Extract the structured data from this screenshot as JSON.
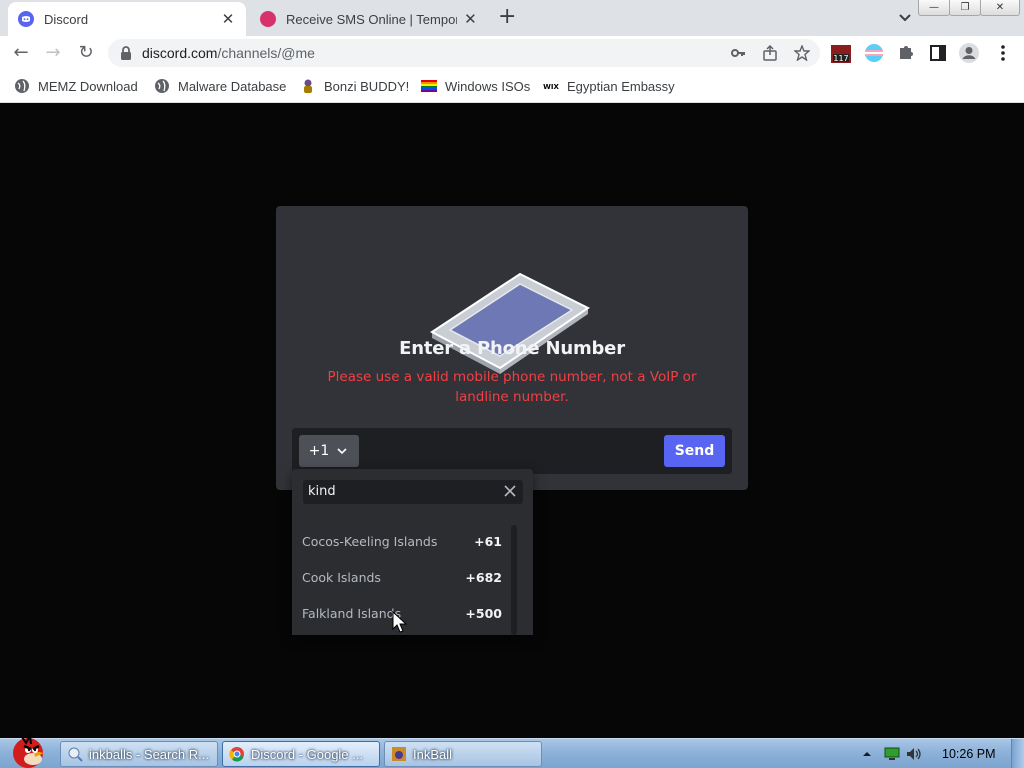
{
  "browser": {
    "tabs": [
      {
        "title": "Discord",
        "active": true,
        "icon": "discord-icon"
      },
      {
        "title": "Receive SMS Online | Tempora",
        "active": false,
        "icon": "sms-site-icon"
      }
    ],
    "window_buttons": {
      "minimize": "—",
      "restore": "❐",
      "close": "✕"
    },
    "url_host": "discord.com",
    "url_path": "/channels/@me",
    "extension_badge": "117",
    "bookmarks": [
      {
        "label": "MEMZ Download",
        "icon": "globe-icon"
      },
      {
        "label": "Malware Database",
        "icon": "globe-icon"
      },
      {
        "label": "Bonzi BUDDY!",
        "icon": "bonzi-icon"
      },
      {
        "label": "Windows ISOs",
        "icon": "rainbow-flag-icon"
      },
      {
        "label": "Egyptian Embassy",
        "icon": "wix-icon"
      }
    ]
  },
  "modal": {
    "title": "Enter a Phone Number",
    "error": "Please use a valid mobile phone number, not a VoIP or landline number.",
    "country_code": "+1",
    "send_label": "Send"
  },
  "country_popout": {
    "search_value": "kind",
    "items": [
      {
        "name": "Cocos-Keeling Islands",
        "code": "+61"
      },
      {
        "name": "Cook Islands",
        "code": "+682"
      },
      {
        "name": "Falkland Islands",
        "code": "+500"
      }
    ]
  },
  "taskbar": {
    "tasks": [
      {
        "label": "inkballs - Search R...",
        "icon": "search-app-icon"
      },
      {
        "label": "Discord - Google ...",
        "icon": "chrome-icon"
      },
      {
        "label": "InkBall",
        "icon": "inkball-icon"
      }
    ],
    "clock": "10:26 PM"
  },
  "colors": {
    "discord_blurple": "#5865f2",
    "error_red": "#f23f43",
    "modal_bg": "#313338"
  }
}
